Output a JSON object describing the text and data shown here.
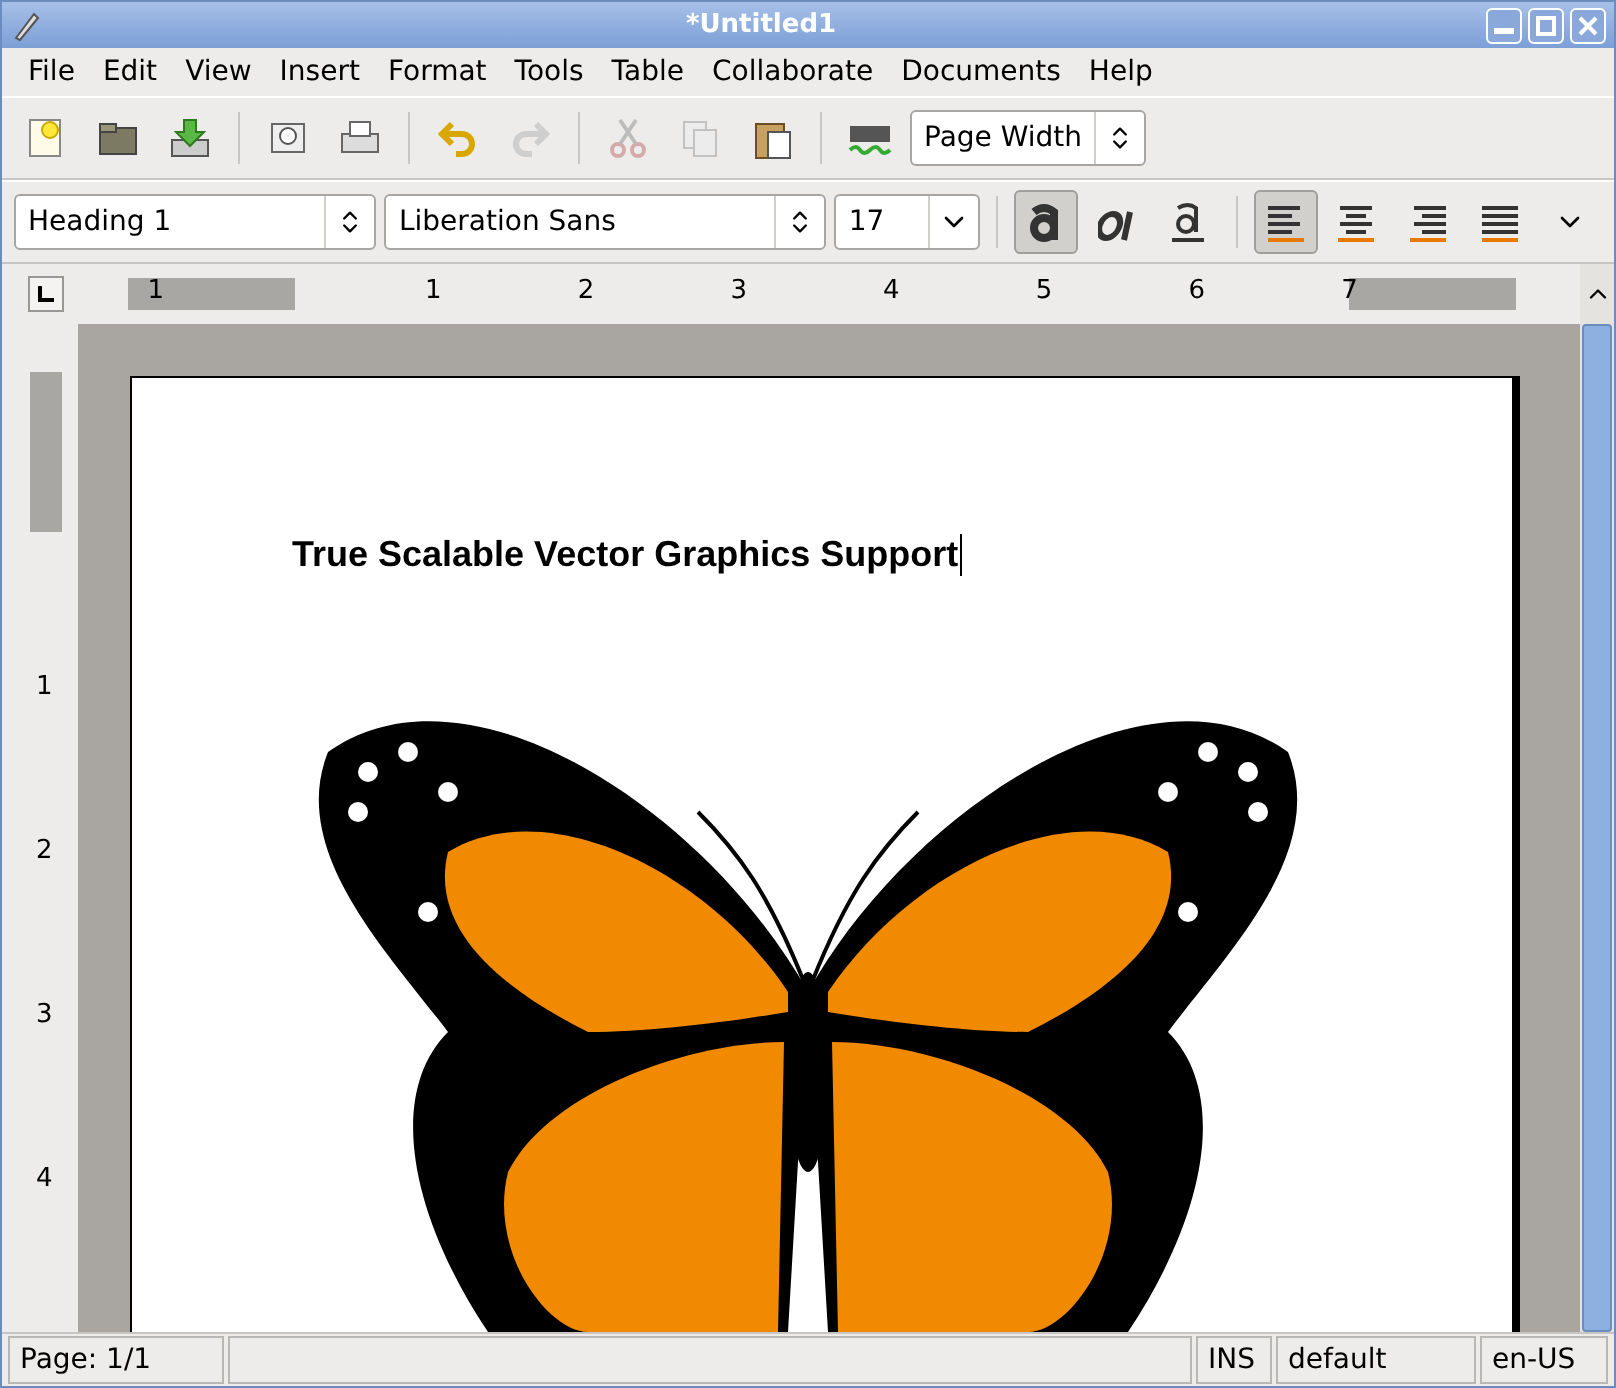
{
  "window": {
    "title": "*Untitled1"
  },
  "menu": [
    {
      "label": "File"
    },
    {
      "label": "Edit"
    },
    {
      "label": "View"
    },
    {
      "label": "Insert"
    },
    {
      "label": "Format"
    },
    {
      "label": "Tools"
    },
    {
      "label": "Table"
    },
    {
      "label": "Collaborate"
    },
    {
      "label": "Documents"
    },
    {
      "label": "Help"
    }
  ],
  "toolbar": [
    {
      "kind": "new",
      "disabled": false
    },
    {
      "kind": "open",
      "disabled": false
    },
    {
      "kind": "save",
      "disabled": false
    },
    {
      "kind": "sep"
    },
    {
      "kind": "preview",
      "disabled": false
    },
    {
      "kind": "print",
      "disabled": false
    },
    {
      "kind": "sep"
    },
    {
      "kind": "undo",
      "disabled": false
    },
    {
      "kind": "redo",
      "disabled": true
    },
    {
      "kind": "sep"
    },
    {
      "kind": "cut",
      "disabled": true
    },
    {
      "kind": "copy",
      "disabled": true
    },
    {
      "kind": "paste",
      "disabled": false
    },
    {
      "kind": "sep"
    },
    {
      "kind": "spell",
      "disabled": false
    }
  ],
  "zoom": {
    "value": "Page Width"
  },
  "format": {
    "style": "Heading 1",
    "font": "Liberation Sans",
    "size": "17"
  },
  "text_buttons": [
    {
      "kind": "bold",
      "selected": true
    },
    {
      "kind": "italic",
      "selected": false
    },
    {
      "kind": "underline",
      "selected": false
    }
  ],
  "align_buttons": [
    {
      "kind": "left",
      "selected": true
    },
    {
      "kind": "center",
      "selected": false
    },
    {
      "kind": "right",
      "selected": false
    },
    {
      "kind": "justify",
      "selected": false
    }
  ],
  "ruler": {
    "labels": [
      "1",
      "1",
      "2",
      "3",
      "4",
      "5",
      "6",
      "7"
    ]
  },
  "vruler": {
    "labels": [
      "1",
      "2",
      "3",
      "4"
    ]
  },
  "document": {
    "heading": "True Scalable Vector Graphics Support"
  },
  "status_bar": {
    "page": "Page: 1/1",
    "mode": "INS",
    "style": "default",
    "language": "en-US"
  }
}
